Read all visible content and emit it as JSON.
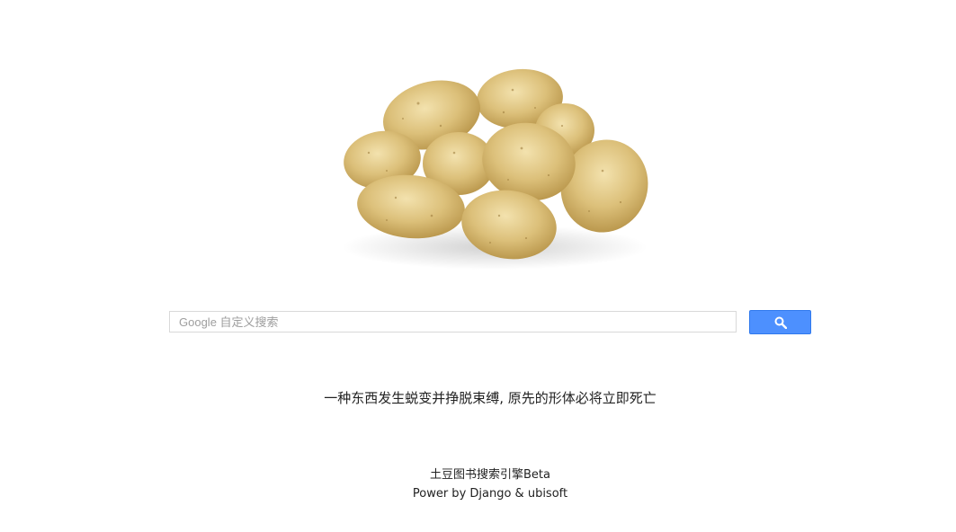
{
  "hero": {
    "image_name": "potatoes-image"
  },
  "search": {
    "placeholder": "Google 自定义搜索",
    "button_icon": "search-icon",
    "button_color": "#4d90fe"
  },
  "tagline": "一种东西发生蜕变并挣脱束缚, 原先的形体必将立即死亡",
  "footer": {
    "line1": "土豆图书搜索引擎Beta",
    "line2": "Power by Django & ubisoft"
  }
}
